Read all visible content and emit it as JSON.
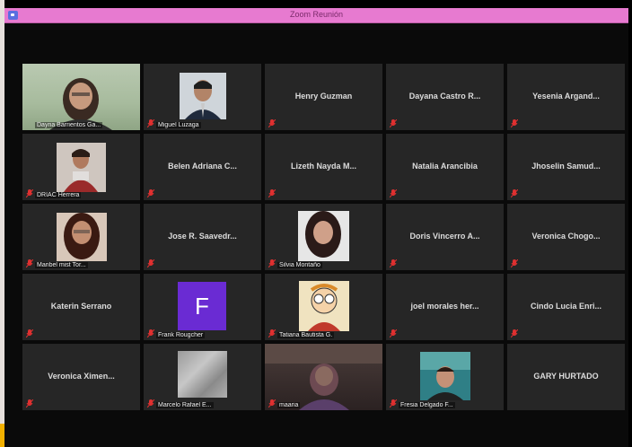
{
  "window": {
    "title": "Zoom Reunión"
  },
  "colors": {
    "titlebar": "#e77ad0",
    "tile_bg": "#262626",
    "active_border": "#c8e07a",
    "mic_muted": "#e03030",
    "avatar_bg": "#6a2bd3"
  },
  "participants": [
    {
      "name": "Dayna Barrientos Ga...",
      "type": "video",
      "active": true
    },
    {
      "name": "Miguel Luzaga",
      "type": "photo"
    },
    {
      "name": "Henry Guzman",
      "type": "name"
    },
    {
      "name": "Dayana Castro R...",
      "type": "name"
    },
    {
      "name": "Yesenia Argand...",
      "type": "name"
    },
    {
      "name": "DRIAC Herrera",
      "type": "photo"
    },
    {
      "name": "Belen Adriana C...",
      "type": "name"
    },
    {
      "name": "Lizeth Nayda M...",
      "type": "name"
    },
    {
      "name": "Natalia Arancibia",
      "type": "name"
    },
    {
      "name": "Jhoselin Samud...",
      "type": "name"
    },
    {
      "name": "Maribel mist Tor...",
      "type": "photo"
    },
    {
      "name": "Jose R. Saavedr...",
      "type": "name"
    },
    {
      "name": "Silvia Montaño",
      "type": "photo"
    },
    {
      "name": "Doris Vincerro A...",
      "type": "name"
    },
    {
      "name": "Veronica Chogo...",
      "type": "name"
    },
    {
      "name": "Katerin Serrano",
      "type": "name"
    },
    {
      "name": "Frank Rougcher",
      "type": "avatar",
      "initial": "F"
    },
    {
      "name": "Tatiana Bautista G.",
      "type": "photo"
    },
    {
      "name": "joel morales her...",
      "type": "name"
    },
    {
      "name": "Cindo Lucia Enri...",
      "type": "name"
    },
    {
      "name": "Veronica Ximen...",
      "type": "name"
    },
    {
      "name": "Marcelo Rafael E...",
      "type": "blur"
    },
    {
      "name": "maaria",
      "type": "video"
    },
    {
      "name": "Fresia Delgado F...",
      "type": "photo"
    },
    {
      "name": "GARY HURTADO",
      "type": "name"
    }
  ]
}
